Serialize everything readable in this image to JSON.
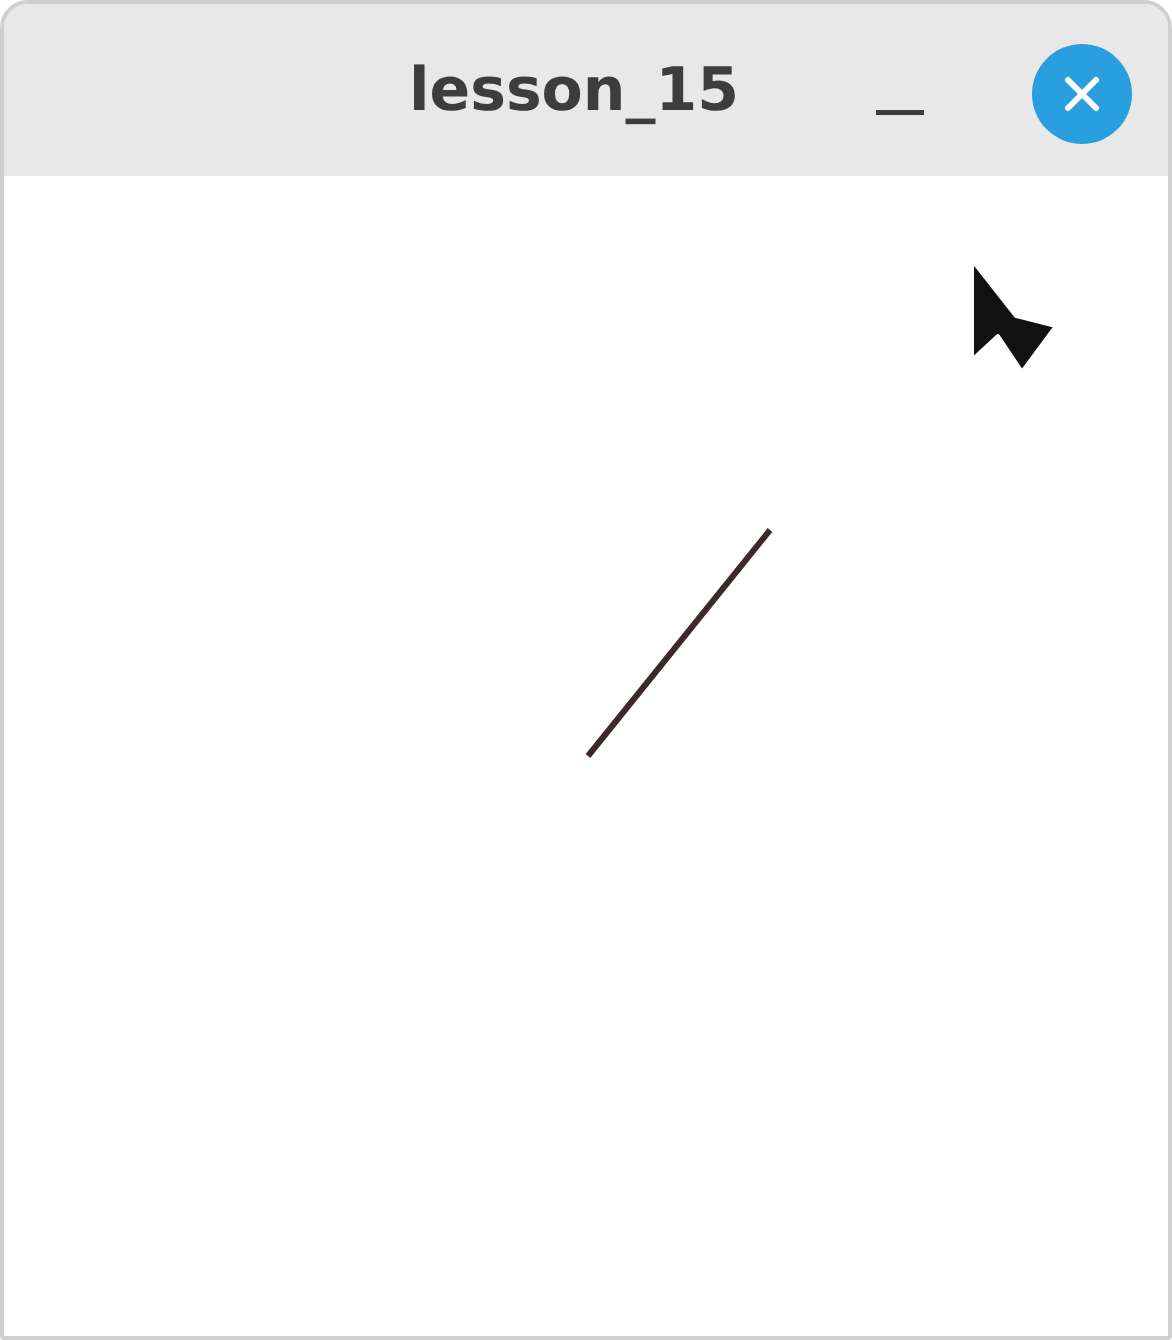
{
  "window": {
    "title": "lesson_15"
  }
}
